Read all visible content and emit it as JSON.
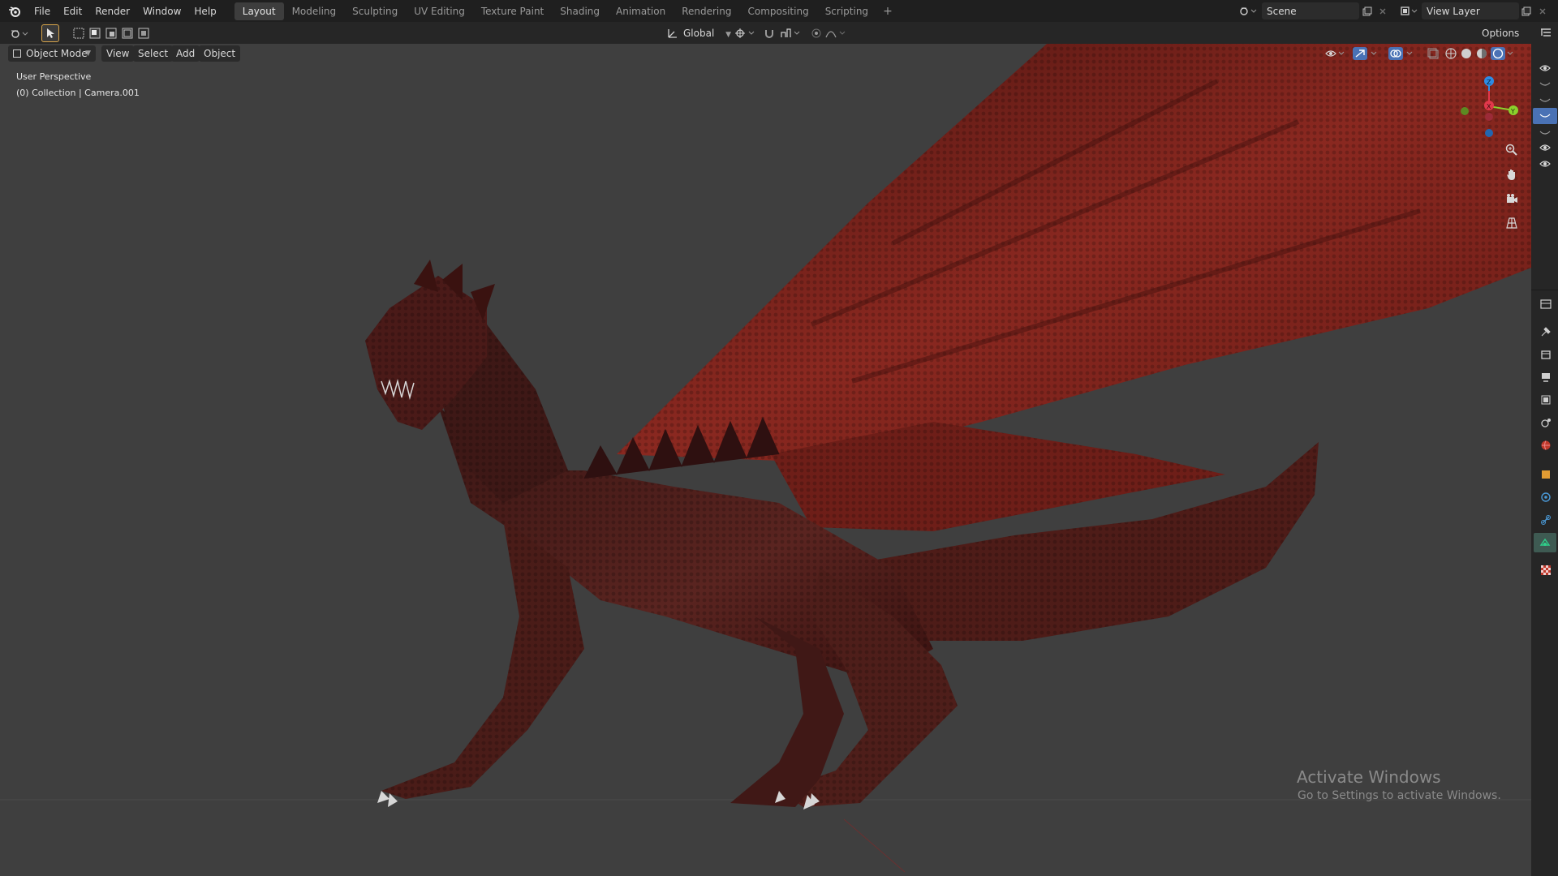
{
  "menu": [
    "File",
    "Edit",
    "Render",
    "Window",
    "Help"
  ],
  "workspaces": [
    {
      "label": "Layout",
      "active": true
    },
    {
      "label": "Modeling",
      "active": false
    },
    {
      "label": "Sculpting",
      "active": false
    },
    {
      "label": "UV Editing",
      "active": false
    },
    {
      "label": "Texture Paint",
      "active": false
    },
    {
      "label": "Shading",
      "active": false
    },
    {
      "label": "Animation",
      "active": false
    },
    {
      "label": "Rendering",
      "active": false
    },
    {
      "label": "Compositing",
      "active": false
    },
    {
      "label": "Scripting",
      "active": false
    }
  ],
  "add_workspace": "+",
  "scene": {
    "label": "Scene"
  },
  "view_layer": {
    "label": "View Layer"
  },
  "header": {
    "orientation": "Global",
    "options": "Options"
  },
  "viewport_header": {
    "mode": "Object Mode",
    "view": "View",
    "select": "Select",
    "add": "Add",
    "object": "Object"
  },
  "overlay_text": {
    "perspective": "User Perspective",
    "collection": "(0) Collection | Camera.001"
  },
  "gizmo": {
    "x_color": "#e2384b",
    "y_color": "#8bd12c",
    "z_color": "#2d8ce6"
  },
  "watermark": {
    "title": "Activate Windows",
    "subtitle": "Go to Settings to activate Windows."
  },
  "colors": {
    "accent": "#4a72b5",
    "dragon": "#8a2820",
    "viewport_bg": "#3f3f3f"
  }
}
